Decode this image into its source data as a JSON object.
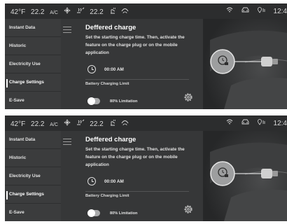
{
  "screens": [
    {
      "status_bar": {
        "outside_temp": "42°F",
        "cabin_temp_left": "22.2",
        "ac_label": "A/C",
        "fan_icon": "fan-icon",
        "seat_icon": "seat-heat-icon",
        "cabin_temp_right": "22.2",
        "time": "12:4"
      },
      "sidebar": {
        "items": [
          {
            "label": "Instant Data"
          },
          {
            "label": "Historic"
          },
          {
            "label": "Electricity Use"
          },
          {
            "label": "Charge Settings"
          },
          {
            "label": "E-Save"
          }
        ],
        "active_index": 3
      },
      "panel": {
        "title": "Deffered charge",
        "description": "Set the starting charge time. Then, activate the feature on the charge plug or on the mobile application",
        "start_time": "00:00 AM",
        "limit_title": "Battery Charging Limit",
        "limit_label": "80% Limitation",
        "limit_on": false
      }
    },
    {
      "status_bar": {
        "outside_temp": "42°F",
        "cabin_temp_left": "22.2",
        "ac_label": "A/C",
        "fan_icon": "fan-icon",
        "seat_icon": "seat-heat-icon",
        "cabin_temp_right": "22.2",
        "time": "12:4"
      },
      "sidebar": {
        "items": [
          {
            "label": "Instant Data"
          },
          {
            "label": "Historic"
          },
          {
            "label": "Electricity Use"
          },
          {
            "label": "Charge Settings"
          },
          {
            "label": "E-Save"
          }
        ],
        "active_index": 3
      },
      "panel": {
        "title": "Deffered charge",
        "description": "Set the starting charge time. Then, activate the feature on the charge plug or on the mobile application",
        "start_time": "00:00 AM",
        "limit_title": "Battery Charging Limit",
        "limit_label": "80% Limitation",
        "limit_on": false
      }
    }
  ],
  "colors": {
    "background": "#363738",
    "sidebar": "#3b3c3d",
    "text": "#e8e8e8",
    "toggle_track": "#a9aaab",
    "plug_circle": "#9d9e9f"
  }
}
